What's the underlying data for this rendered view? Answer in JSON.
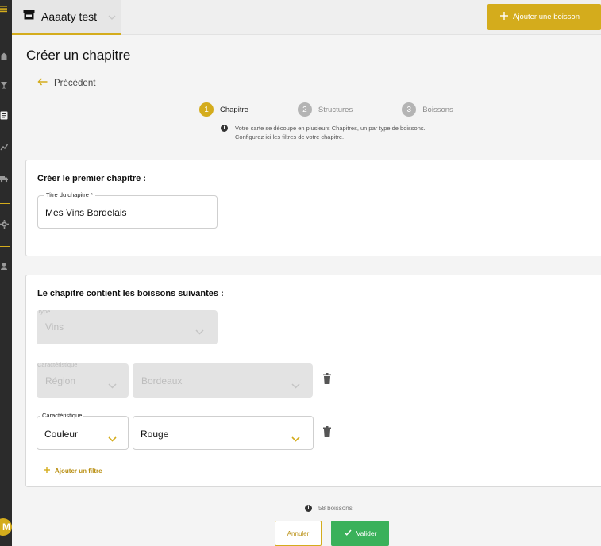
{
  "app": {
    "venue_name": "Aaaaty test",
    "add_drink_button": "Ajouter une boisson",
    "avatar_initial": "M"
  },
  "page": {
    "title": "Créer un chapitre",
    "back_label": "Précédent"
  },
  "stepper": {
    "steps": [
      {
        "number": "1",
        "label": "Chapitre",
        "state": "active"
      },
      {
        "number": "2",
        "label": "Structures",
        "state": "idle"
      },
      {
        "number": "3",
        "label": "Boissons",
        "state": "idle"
      }
    ],
    "info_line1": "Votre carte se découpe en plusieurs Chapitres, un par type de boissons.",
    "info_line2": "Configurez ici les filtres de votre chapitre."
  },
  "chapter_card": {
    "title": "Créer le premier chapitre :",
    "name_field": {
      "label": "Titre du chapitre *",
      "value": "Mes Vins Bordelais"
    }
  },
  "contents_card": {
    "title": "Le chapitre contient les boissons suivantes :",
    "type_select": {
      "label": "Type",
      "value": "Vins",
      "disabled": true
    },
    "filters": [
      {
        "label": "Caractéristique",
        "characteristic": "Région",
        "value": "Bordeaux",
        "disabled": true
      },
      {
        "label": "Caractéristique",
        "characteristic": "Couleur",
        "value": "Rouge",
        "disabled": false
      }
    ],
    "add_filter_label": "Ajouter un filtre"
  },
  "footer": {
    "count_label": "58 boissons",
    "cancel_label": "Annuler",
    "validate_label": "Valider"
  },
  "colors": {
    "accent": "#d4ac1c",
    "success": "#3ab15a",
    "rail": "#2b2b2b"
  }
}
